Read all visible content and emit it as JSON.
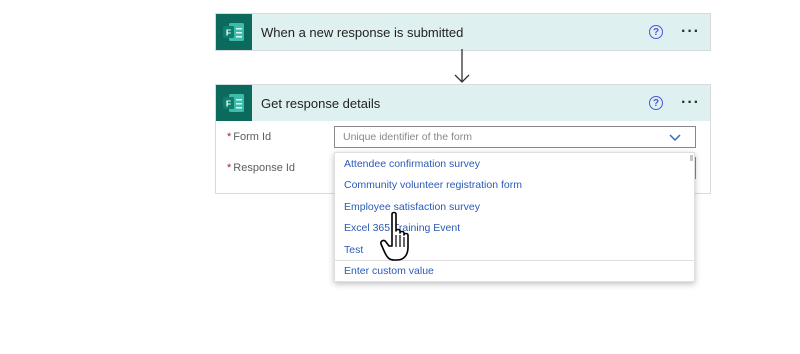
{
  "trigger_card": {
    "title": "When a new response is submitted",
    "app_icon": "forms-icon",
    "help_glyph": "?",
    "more_glyph": "···"
  },
  "action_card": {
    "title": "Get response details",
    "app_icon": "forms-icon",
    "help_glyph": "?",
    "more_glyph": "···",
    "fields": {
      "form_id": {
        "label": "Form Id",
        "required_mark": "*",
        "placeholder": "Unique identifier of the form"
      },
      "response_id": {
        "label": "Response Id",
        "required_mark": "*"
      }
    }
  },
  "dropdown": {
    "options": [
      "Attendee confirmation survey",
      "Community volunteer registration form",
      "Employee satisfaction survey",
      "Excel 365 Training Event",
      "Test"
    ],
    "custom_value_label": "Enter custom value"
  },
  "colors": {
    "header_bg": "#dff0f1",
    "forms_brand": "#0b6a5c",
    "link_blue": "#2b5bb5",
    "help_blue": "#4a57d6"
  }
}
